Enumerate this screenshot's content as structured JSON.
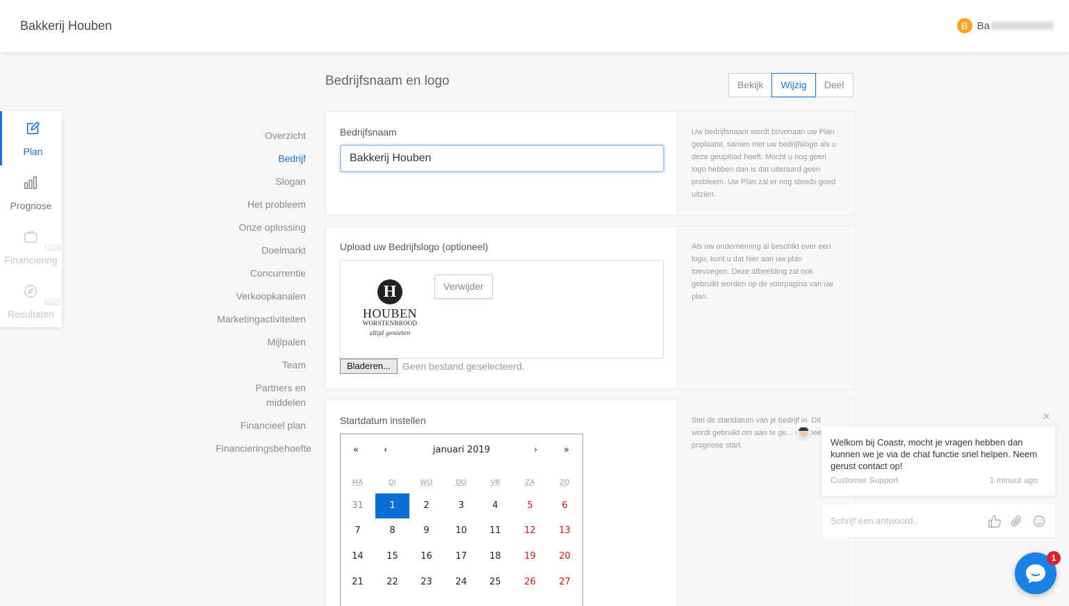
{
  "header": {
    "brand": "Bakkerij Houben",
    "user_initial": "B",
    "user_name_visible": "Ba"
  },
  "rail": {
    "items": [
      {
        "label": "Plan",
        "icon": "edit-icon",
        "state": "active"
      },
      {
        "label": "Prognose",
        "icon": "bar-chart-icon",
        "state": "normal"
      },
      {
        "label": "Financiering",
        "icon": "wallet-icon",
        "state": "disabled",
        "badge": "PRO"
      },
      {
        "label": "Resultaten",
        "icon": "compass-icon",
        "state": "disabled",
        "badge": "PRO"
      }
    ]
  },
  "sections": {
    "items": [
      "Overzicht",
      "Bedrijf",
      "Slogan",
      "Het probleem",
      "Onze oplossing",
      "Doelmarkt",
      "Concurrentie",
      "Verkoopkanalen",
      "Marketingactiviteiten",
      "Mijlpalen",
      "Team",
      "Partners en middelen",
      "Financieel plan",
      "Financieringsbehoefte"
    ],
    "active": "Bedrijf"
  },
  "page": {
    "title": "Bedrijfsnaam en logo",
    "modes": [
      "Bekijk",
      "Wijzig",
      "Deel"
    ],
    "active_mode": "Wijzig"
  },
  "name_card": {
    "label": "Bedrijfsnaam",
    "value": "Bakkerij Houben",
    "help": "Uw bedrijfsnaam wordt bovenaan uw Plan geplaatst, samen met uw bedrijfslogo als u deze geupload heeft. Mocht u nog geen logo hebben dan is dat uiteraard geen probleem. Uw Plan zal er nog steeds goed uitzien."
  },
  "logo_card": {
    "label": "Upload uw Bedrijfslogo (optioneel)",
    "logo_letter": "H",
    "logo_word": "HOUBEN",
    "logo_sub": "WORSTENBROOD",
    "logo_tagline": "altijd genieten",
    "remove_label": "Verwijder",
    "browse_label": "Bladeren...",
    "file_status": "Geen bestand geselecteerd.",
    "help": "Als uw onderneming al beschikt over een logo, kunt u dat hier aan uw plan toevoegen. Deze afbeelding zal ook gebruikt worden op de voorpagina van uw plan."
  },
  "date_card": {
    "label": "Startdatum instellen",
    "help": "Stel de startdatum van je bedrijf in. Dit wordt gebruikt om aan te ge... wanneer de prognose start.",
    "calendar": {
      "month_label": "januari 2019",
      "nav_prev_year": "«",
      "nav_prev": "‹",
      "nav_next": "›",
      "nav_next_year": "»",
      "weekdays": [
        "MA",
        "DI",
        "WO",
        "DO",
        "VR",
        "ZA",
        "ZO"
      ],
      "weeks": [
        [
          "31",
          "1",
          "2",
          "3",
          "4",
          "5",
          "6"
        ],
        [
          "7",
          "8",
          "9",
          "10",
          "11",
          "12",
          "13"
        ],
        [
          "14",
          "15",
          "16",
          "17",
          "18",
          "19",
          "20"
        ],
        [
          "21",
          "22",
          "23",
          "24",
          "25",
          "26",
          "27"
        ]
      ],
      "selected": "1"
    }
  },
  "chat": {
    "close": "×",
    "message": "Welkom bij Coastr, mocht je vragen hebben dan kunnen we je via de chat functie snel helpen. Neem gerust contact op!",
    "agent": "Customer Support",
    "time": "1 minuut ago",
    "reply_placeholder": "Schrijf een antwoord..",
    "unread": "1"
  },
  "colors": {
    "accent": "#1a73d1",
    "weekend": "#dd1111",
    "selected_day": "#0a6fd7",
    "avatar": "#f5a623",
    "badge": "#e02030"
  }
}
